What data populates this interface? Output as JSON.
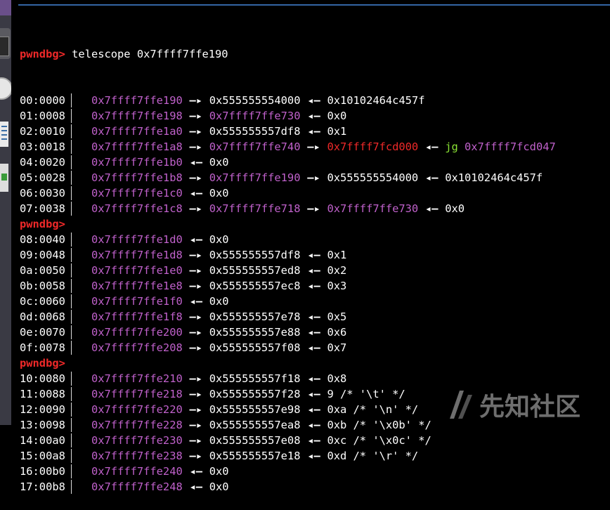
{
  "colors": {
    "prompt": "#ef2929",
    "address": "#c061cb",
    "code": "#ef2929",
    "instruction": "#8ae234",
    "accent": "#3465a4"
  },
  "prompt": "pwndbg>",
  "command": "telescope 0x7ffff7ffe190",
  "lines": [
    {
      "kind": "row",
      "offset": "00:0000",
      "segs": [
        {
          "t": "0x7ffff7ffe190",
          "c": "addr"
        },
        {
          "t": "—▸",
          "c": "arr"
        },
        {
          "t": "0x555555554000",
          "c": "val"
        },
        {
          "t": "◂—",
          "c": "arr"
        },
        {
          "t": "0x10102464c457f",
          "c": "val"
        }
      ]
    },
    {
      "kind": "row",
      "offset": "01:0008",
      "segs": [
        {
          "t": "0x7ffff7ffe198",
          "c": "addr"
        },
        {
          "t": "—▸",
          "c": "arr"
        },
        {
          "t": "0x7ffff7ffe730",
          "c": "addr"
        },
        {
          "t": "◂—",
          "c": "arr"
        },
        {
          "t": "0x0",
          "c": "val"
        }
      ]
    },
    {
      "kind": "row",
      "offset": "02:0010",
      "segs": [
        {
          "t": "0x7ffff7ffe1a0",
          "c": "addr"
        },
        {
          "t": "—▸",
          "c": "arr"
        },
        {
          "t": "0x555555557df8",
          "c": "val"
        },
        {
          "t": "◂—",
          "c": "arr"
        },
        {
          "t": "0x1",
          "c": "val"
        }
      ]
    },
    {
      "kind": "row",
      "offset": "03:0018",
      "segs": [
        {
          "t": "0x7ffff7ffe1a8",
          "c": "addr"
        },
        {
          "t": "—▸",
          "c": "arr"
        },
        {
          "t": "0x7ffff7ffe740",
          "c": "addr"
        },
        {
          "t": "—▸",
          "c": "arr"
        },
        {
          "t": "0x7ffff7fcd000",
          "c": "red"
        },
        {
          "t": "◂—",
          "c": "arr"
        },
        {
          "t": "jg ",
          "c": "jg"
        },
        {
          "t": "0x7ffff7fcd047",
          "c": "addr"
        }
      ]
    },
    {
      "kind": "row",
      "offset": "04:0020",
      "segs": [
        {
          "t": "0x7ffff7ffe1b0",
          "c": "addr"
        },
        {
          "t": "◂—",
          "c": "arr"
        },
        {
          "t": "0x0",
          "c": "val"
        }
      ]
    },
    {
      "kind": "row",
      "offset": "05:0028",
      "segs": [
        {
          "t": "0x7ffff7ffe1b8",
          "c": "addr"
        },
        {
          "t": "—▸",
          "c": "arr"
        },
        {
          "t": "0x7ffff7ffe190",
          "c": "addr"
        },
        {
          "t": "—▸",
          "c": "arr"
        },
        {
          "t": "0x555555554000",
          "c": "val"
        },
        {
          "t": "◂—",
          "c": "arr"
        },
        {
          "t": "0x10102464c457f",
          "c": "val"
        }
      ]
    },
    {
      "kind": "row",
      "offset": "06:0030",
      "segs": [
        {
          "t": "0x7ffff7ffe1c0",
          "c": "addr"
        },
        {
          "t": "◂—",
          "c": "arr"
        },
        {
          "t": "0x0",
          "c": "val"
        }
      ]
    },
    {
      "kind": "row",
      "offset": "07:0038",
      "segs": [
        {
          "t": "0x7ffff7ffe1c8",
          "c": "addr"
        },
        {
          "t": "—▸",
          "c": "arr"
        },
        {
          "t": "0x7ffff7ffe718",
          "c": "addr"
        },
        {
          "t": "—▸",
          "c": "arr"
        },
        {
          "t": "0x7ffff7ffe730",
          "c": "addr"
        },
        {
          "t": "◂—",
          "c": "arr"
        },
        {
          "t": "0x0",
          "c": "val"
        }
      ]
    },
    {
      "kind": "prompt"
    },
    {
      "kind": "row",
      "offset": "08:0040",
      "segs": [
        {
          "t": "0x7ffff7ffe1d0",
          "c": "addr"
        },
        {
          "t": "◂—",
          "c": "arr"
        },
        {
          "t": "0x0",
          "c": "val"
        }
      ]
    },
    {
      "kind": "row",
      "offset": "09:0048",
      "segs": [
        {
          "t": "0x7ffff7ffe1d8",
          "c": "addr"
        },
        {
          "t": "—▸",
          "c": "arr"
        },
        {
          "t": "0x555555557df8",
          "c": "val"
        },
        {
          "t": "◂—",
          "c": "arr"
        },
        {
          "t": "0x1",
          "c": "val"
        }
      ]
    },
    {
      "kind": "row",
      "offset": "0a:0050",
      "segs": [
        {
          "t": "0x7ffff7ffe1e0",
          "c": "addr"
        },
        {
          "t": "—▸",
          "c": "arr"
        },
        {
          "t": "0x555555557ed8",
          "c": "val"
        },
        {
          "t": "◂—",
          "c": "arr"
        },
        {
          "t": "0x2",
          "c": "val"
        }
      ]
    },
    {
      "kind": "row",
      "offset": "0b:0058",
      "segs": [
        {
          "t": "0x7ffff7ffe1e8",
          "c": "addr"
        },
        {
          "t": "—▸",
          "c": "arr"
        },
        {
          "t": "0x555555557ec8",
          "c": "val"
        },
        {
          "t": "◂—",
          "c": "arr"
        },
        {
          "t": "0x3",
          "c": "val"
        }
      ]
    },
    {
      "kind": "row",
      "offset": "0c:0060",
      "segs": [
        {
          "t": "0x7ffff7ffe1f0",
          "c": "addr"
        },
        {
          "t": "◂—",
          "c": "arr"
        },
        {
          "t": "0x0",
          "c": "val"
        }
      ]
    },
    {
      "kind": "row",
      "offset": "0d:0068",
      "segs": [
        {
          "t": "0x7ffff7ffe1f8",
          "c": "addr"
        },
        {
          "t": "—▸",
          "c": "arr"
        },
        {
          "t": "0x555555557e78",
          "c": "val"
        },
        {
          "t": "◂—",
          "c": "arr"
        },
        {
          "t": "0x5",
          "c": "val"
        }
      ]
    },
    {
      "kind": "row",
      "offset": "0e:0070",
      "segs": [
        {
          "t": "0x7ffff7ffe200",
          "c": "addr"
        },
        {
          "t": "—▸",
          "c": "arr"
        },
        {
          "t": "0x555555557e88",
          "c": "val"
        },
        {
          "t": "◂—",
          "c": "arr"
        },
        {
          "t": "0x6",
          "c": "val"
        }
      ]
    },
    {
      "kind": "row",
      "offset": "0f:0078",
      "segs": [
        {
          "t": "0x7ffff7ffe208",
          "c": "addr"
        },
        {
          "t": "—▸",
          "c": "arr"
        },
        {
          "t": "0x555555557f08",
          "c": "val"
        },
        {
          "t": "◂—",
          "c": "arr"
        },
        {
          "t": "0x7",
          "c": "val"
        }
      ]
    },
    {
      "kind": "prompt"
    },
    {
      "kind": "row",
      "offset": "10:0080",
      "segs": [
        {
          "t": "0x7ffff7ffe210",
          "c": "addr"
        },
        {
          "t": "—▸",
          "c": "arr"
        },
        {
          "t": "0x555555557f18",
          "c": "val"
        },
        {
          "t": "◂—",
          "c": "arr"
        },
        {
          "t": "0x8",
          "c": "val"
        }
      ]
    },
    {
      "kind": "row",
      "offset": "11:0088",
      "segs": [
        {
          "t": "0x7ffff7ffe218",
          "c": "addr"
        },
        {
          "t": "—▸",
          "c": "arr"
        },
        {
          "t": "0x555555557f28",
          "c": "val"
        },
        {
          "t": "◂—",
          "c": "arr"
        },
        {
          "t": "9 /* '\\t' */",
          "c": "val"
        }
      ]
    },
    {
      "kind": "row",
      "offset": "12:0090",
      "segs": [
        {
          "t": "0x7ffff7ffe220",
          "c": "addr"
        },
        {
          "t": "—▸",
          "c": "arr"
        },
        {
          "t": "0x555555557e98",
          "c": "val"
        },
        {
          "t": "◂—",
          "c": "arr"
        },
        {
          "t": "0xa /* '\\n' */",
          "c": "val"
        }
      ]
    },
    {
      "kind": "row",
      "offset": "13:0098",
      "segs": [
        {
          "t": "0x7ffff7ffe228",
          "c": "addr"
        },
        {
          "t": "—▸",
          "c": "arr"
        },
        {
          "t": "0x555555557ea8",
          "c": "val"
        },
        {
          "t": "◂—",
          "c": "arr"
        },
        {
          "t": "0xb /* '\\x0b' */",
          "c": "val"
        }
      ]
    },
    {
      "kind": "row",
      "offset": "14:00a0",
      "segs": [
        {
          "t": "0x7ffff7ffe230",
          "c": "addr"
        },
        {
          "t": "—▸",
          "c": "arr"
        },
        {
          "t": "0x555555557e08",
          "c": "val"
        },
        {
          "t": "◂—",
          "c": "arr"
        },
        {
          "t": "0xc /* '\\x0c' */",
          "c": "val"
        }
      ]
    },
    {
      "kind": "row",
      "offset": "15:00a8",
      "segs": [
        {
          "t": "0x7ffff7ffe238",
          "c": "addr"
        },
        {
          "t": "—▸",
          "c": "arr"
        },
        {
          "t": "0x555555557e18",
          "c": "val"
        },
        {
          "t": "◂—",
          "c": "arr"
        },
        {
          "t": "0xd /* '\\r' */",
          "c": "val"
        }
      ]
    },
    {
      "kind": "row",
      "offset": "16:00b0",
      "segs": [
        {
          "t": "0x7ffff7ffe240",
          "c": "addr"
        },
        {
          "t": "◂—",
          "c": "arr"
        },
        {
          "t": "0x0",
          "c": "val"
        }
      ]
    },
    {
      "kind": "row",
      "offset": "17:00b8",
      "segs": [
        {
          "t": "0x7ffff7ffe248",
          "c": "addr"
        },
        {
          "t": "◂—",
          "c": "arr"
        },
        {
          "t": "0x0",
          "c": "val"
        }
      ]
    }
  ],
  "watermark": {
    "text": "先知社区",
    "icon": "xianzhi-logo-icon"
  }
}
